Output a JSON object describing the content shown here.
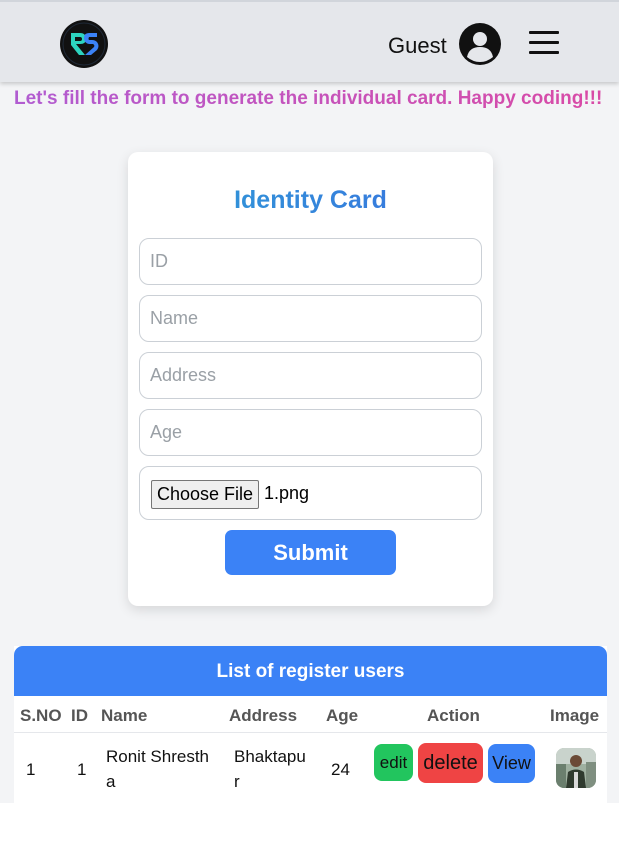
{
  "header": {
    "logo_text": "RS",
    "user_name": "Guest"
  },
  "tagline": "Let's fill the form to generate the individual card. Happy coding!!!",
  "form": {
    "title": "Identity Card",
    "id_placeholder": "ID",
    "name_placeholder": "Name",
    "address_placeholder": "Address",
    "age_placeholder": "Age",
    "file_button": "Choose File",
    "file_name": "1.png",
    "submit_label": "Submit"
  },
  "table": {
    "title": "List of register users",
    "columns": [
      "S.NO",
      "ID",
      "Name",
      "Address",
      "Age",
      "Action",
      "Image"
    ],
    "rows": [
      {
        "sno": "1",
        "id": "1",
        "name_line1": "Ronit Shresth",
        "name_line2": "a",
        "address_line1": "Bhaktapu",
        "address_line2": "r",
        "age": "24",
        "edit_label": "edit",
        "delete_label": "delete",
        "view_label": "View"
      }
    ]
  },
  "colors": {
    "primary": "#3b82f6",
    "edit": "#22c55e",
    "delete": "#ef4444"
  }
}
